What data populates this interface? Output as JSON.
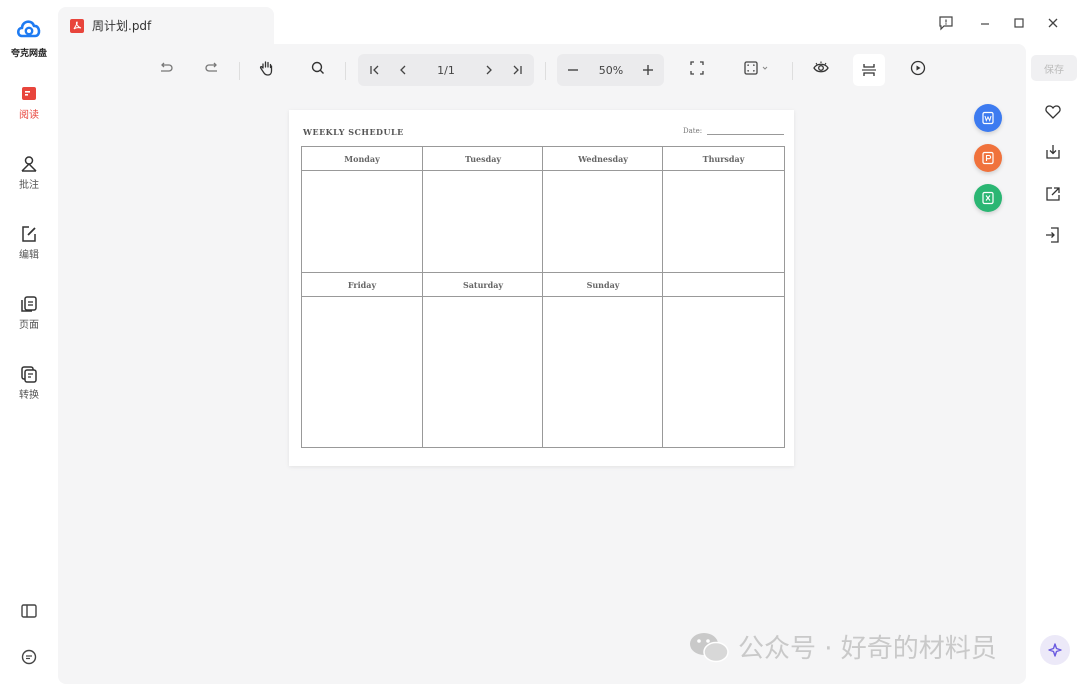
{
  "app": {
    "logo_text": "夸克网盘"
  },
  "sidebar": {
    "items": [
      {
        "label": "阅读",
        "active": true
      },
      {
        "label": "批注",
        "active": false
      },
      {
        "label": "编辑",
        "active": false
      },
      {
        "label": "页面",
        "active": false
      },
      {
        "label": "转换",
        "active": false
      }
    ]
  },
  "tab": {
    "title": "周计划.pdf"
  },
  "toolbar": {
    "page_indicator": "1/1",
    "zoom_level": "50%"
  },
  "document": {
    "title": "WEEKLY SCHEDULE",
    "date_label": "Date:",
    "days_row1": [
      "Monday",
      "Tuesday",
      "Wednesday",
      "Thursday"
    ],
    "days_row2": [
      "Friday",
      "Saturday",
      "Sunday",
      ""
    ]
  },
  "right_panel": {
    "save_label": "保存"
  },
  "watermark": {
    "text": "公众号 · 好奇的材料员"
  },
  "colors": {
    "accent_red": "#e8453c",
    "word_blue": "#3d7bf0",
    "ppt_orange": "#f0723c",
    "excel_green": "#2bb673",
    "viewer_bg": "#f5f5f6"
  }
}
